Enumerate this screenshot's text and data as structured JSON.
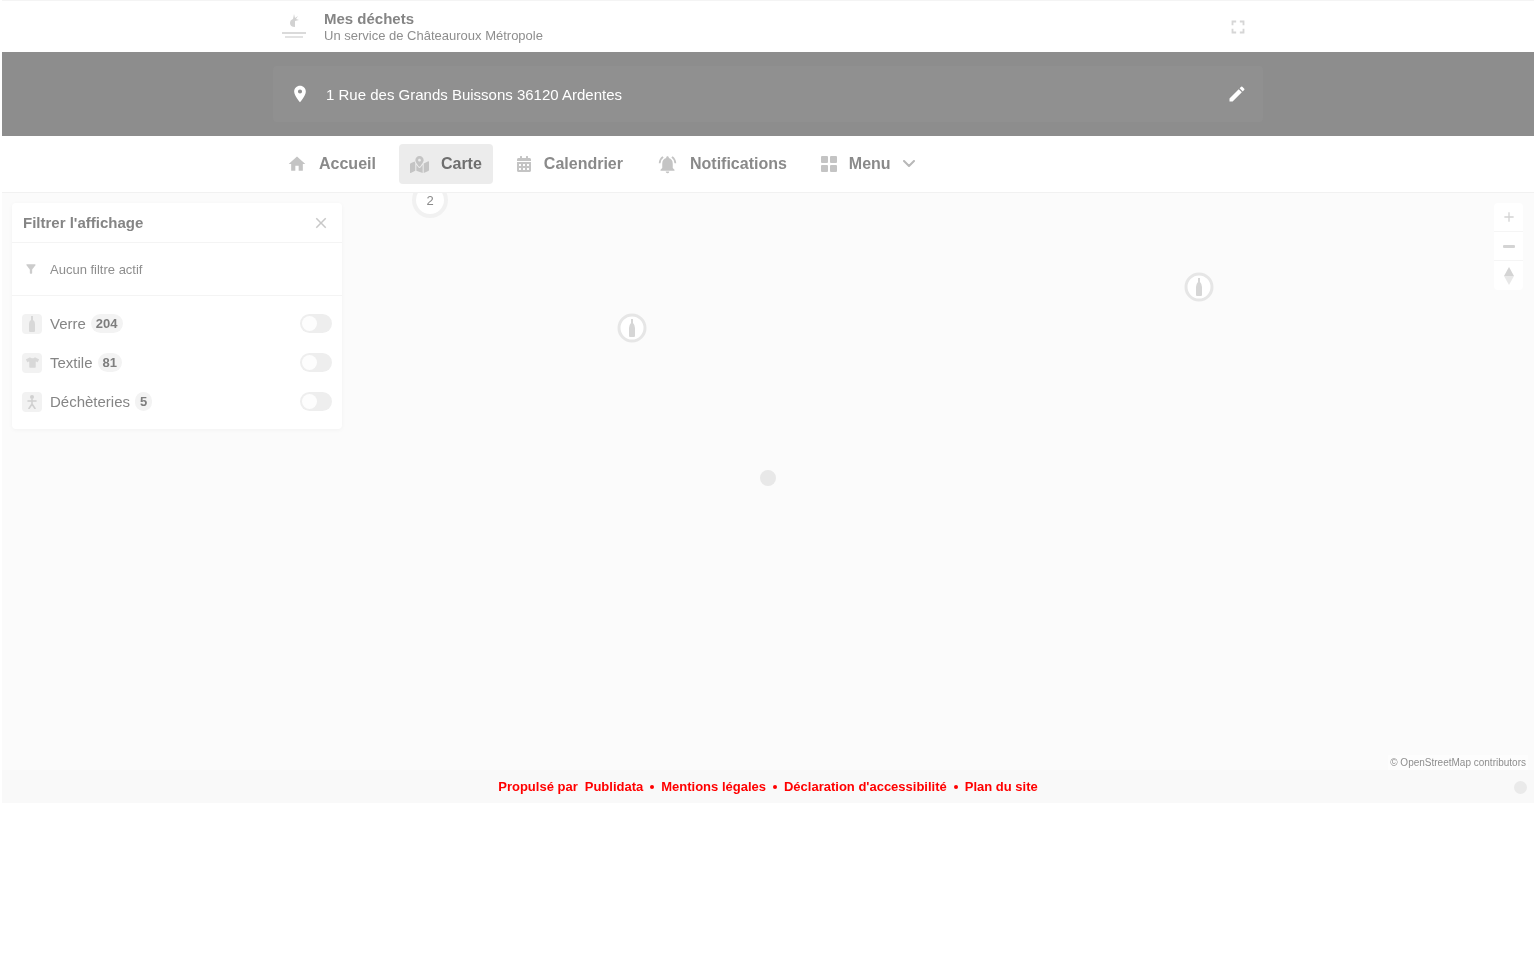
{
  "header": {
    "title": "Mes déchets",
    "subtitle": "Un service de Châteauroux Métropole"
  },
  "address": {
    "value": "1 Rue des Grands Buissons 36120 Ardentes"
  },
  "nav": {
    "tabs": [
      {
        "label": "Accueil",
        "selected": false,
        "kind": "link"
      },
      {
        "label": "Carte",
        "selected": true,
        "kind": "link"
      },
      {
        "label": "Calendrier",
        "selected": false,
        "kind": "link"
      },
      {
        "label": "Notifications",
        "selected": false,
        "kind": "link"
      },
      {
        "label": "Menu",
        "selected": false,
        "kind": "dropdown"
      }
    ]
  },
  "map": {
    "cluster": {
      "count": "2"
    },
    "attribution": "© OpenStreetMap contributors",
    "filter_panel": {
      "title": "Filtrer l'affichage",
      "status": "Aucun filtre actif",
      "layers": [
        {
          "label": "Verre",
          "count": "204",
          "on": false
        },
        {
          "label": "Textile",
          "count": "81",
          "on": false
        },
        {
          "label": "Déchèteries",
          "count": "5",
          "on": false
        }
      ]
    }
  },
  "footer": {
    "powered_by": "Propulsé par",
    "brand": "Publidata",
    "links": [
      "Mentions légales",
      "Déclaration d'accessibilité",
      "Plan du site"
    ]
  }
}
